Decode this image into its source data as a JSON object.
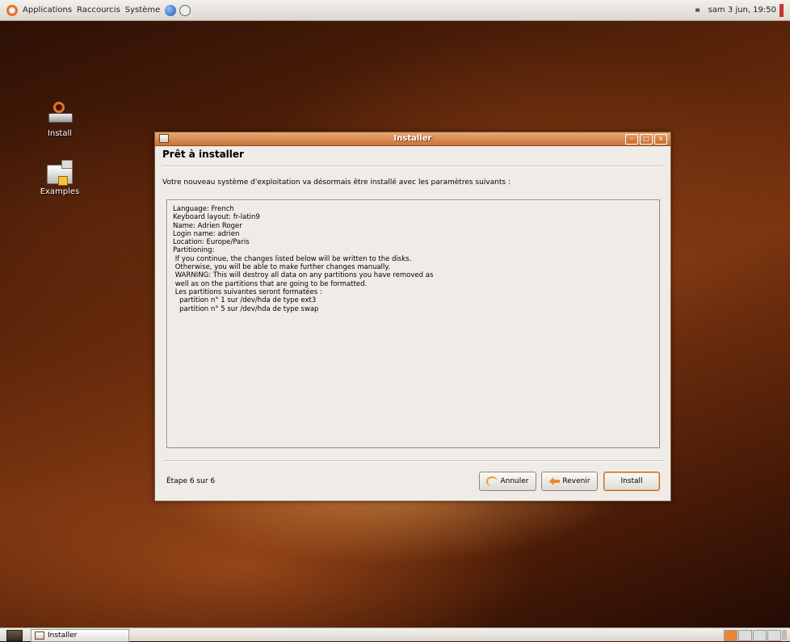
{
  "top_panel": {
    "menus": [
      "Applications",
      "Raccourcis",
      "Système"
    ],
    "clock": "sam  3 jun, 19:50"
  },
  "desktop": {
    "icons": [
      {
        "label": "Install",
        "icon": "install-icon"
      },
      {
        "label": "Examples",
        "icon": "folder-icon"
      }
    ]
  },
  "window": {
    "title": "Installer",
    "heading": "Prêt à installer",
    "intro": "Votre nouveau système d'exploitation va désormais être installé avec les paramètres suivants :",
    "summary_lines": [
      "Language: French",
      "Keyboard layout: fr-latin9",
      "Name: Adrien Roger",
      "Login name: adrien",
      "Location: Europe/Paris",
      "Partitioning:",
      " If you continue, the changes listed below will be written to the disks.",
      " Otherwise, you will be able to make further changes manually.",
      "",
      " WARNING: This will destroy all data on any partitions you have removed as",
      " well as on the partitions that are going to be formatted.",
      "",
      " Les partitions suivantes seront formatées :",
      "   partition n° 1 sur /dev/hda de type ext3",
      "   partition n° 5 sur /dev/hda de type swap"
    ],
    "step": "Étape 6 sur 6",
    "buttons": {
      "cancel": "Annuler",
      "back": "Revenir",
      "install": "Install"
    }
  },
  "bottom_panel": {
    "task": "Installer"
  }
}
